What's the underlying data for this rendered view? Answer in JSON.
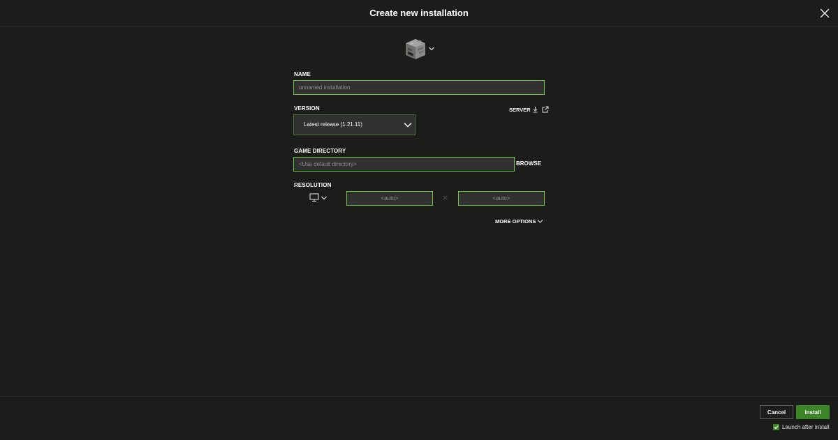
{
  "dialog": {
    "title": "Create new installation"
  },
  "icon_picker": {
    "icon": "furnace-block-icon"
  },
  "name_field": {
    "label": "NAME",
    "placeholder": "unnamed installation",
    "value": ""
  },
  "version_field": {
    "label": "VERSION",
    "selected": "Latest release (1.21.11)"
  },
  "server_link": {
    "label": "SERVER"
  },
  "game_directory": {
    "label": "GAME DIRECTORY",
    "placeholder": "<Use default directory>",
    "value": "",
    "browse_label": "BROWSE"
  },
  "resolution": {
    "label": "RESOLUTION",
    "width_placeholder": "<auto>",
    "height_placeholder": "<auto>",
    "monitor_icon": "monitor-icon"
  },
  "more_options": {
    "label": "MORE OPTIONS"
  },
  "footer": {
    "cancel_label": "Cancel",
    "install_label": "Install",
    "launch_after_install_label": "Launch after Install",
    "launch_after_install_checked": true
  },
  "colors": {
    "background": "#1c1c1b",
    "input_background": "#313131",
    "accent_green": "#3c8527",
    "input_focus_border": "#6cc349"
  }
}
